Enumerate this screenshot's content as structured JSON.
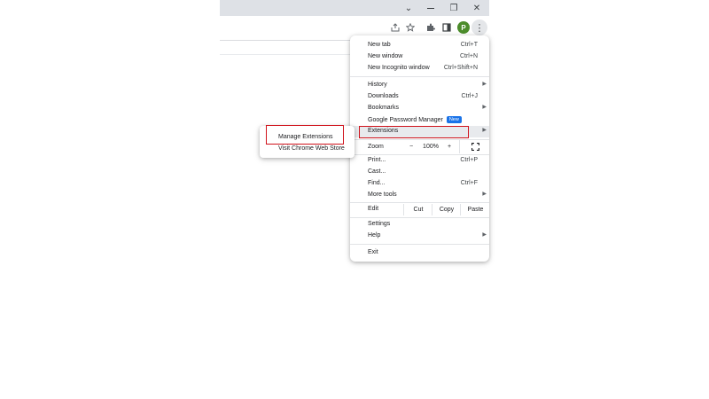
{
  "toolbar": {
    "icons": [
      "share-icon",
      "star-icon",
      "puzzle-icon",
      "side-panel-icon"
    ],
    "profile_initial": "P",
    "menu_icon": "⋮"
  },
  "window_controls": {
    "chevron": "⌄",
    "restore": "❐",
    "close": "✕"
  },
  "main_menu": {
    "new_tab": {
      "label": "New tab",
      "shortcut": "Ctrl+T"
    },
    "new_window": {
      "label": "New window",
      "shortcut": "Ctrl+N"
    },
    "new_incognito": {
      "label": "New Incognito window",
      "shortcut": "Ctrl+Shift+N"
    },
    "history": {
      "label": "History"
    },
    "downloads": {
      "label": "Downloads",
      "shortcut": "Ctrl+J"
    },
    "bookmarks": {
      "label": "Bookmarks"
    },
    "password_manager": {
      "label": "Google Password Manager",
      "badge": "New"
    },
    "extensions": {
      "label": "Extensions"
    },
    "zoom": {
      "label": "Zoom",
      "minus": "−",
      "value": "100%",
      "plus": "+"
    },
    "print": {
      "label": "Print...",
      "shortcut": "Ctrl+P"
    },
    "cast": {
      "label": "Cast..."
    },
    "find": {
      "label": "Find...",
      "shortcut": "Ctrl+F"
    },
    "more_tools": {
      "label": "More tools"
    },
    "edit": {
      "label": "Edit",
      "cut": "Cut",
      "copy": "Copy",
      "paste": "Paste"
    },
    "settings": {
      "label": "Settings"
    },
    "help": {
      "label": "Help"
    },
    "exit": {
      "label": "Exit"
    }
  },
  "extensions_submenu": {
    "manage": "Manage Extensions",
    "store": "Visit Chrome Web Store"
  },
  "colors": {
    "highlight_border": "#d0121b",
    "badge": "#1a73e8",
    "avatar": "#4c8c2b"
  }
}
